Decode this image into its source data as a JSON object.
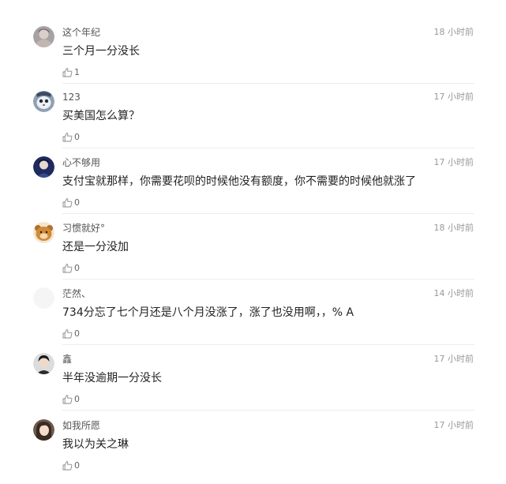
{
  "comments": [
    {
      "username": "这个年纪",
      "time": "18 小时前",
      "content": "三个月一分没长",
      "likes": "1",
      "avatar_icon": "avatar-icon"
    },
    {
      "username": "123",
      "time": "17 小时前",
      "content": "买美国怎么算？",
      "likes": "0",
      "avatar_icon": "avatar-icon"
    },
    {
      "username": "心不够用",
      "time": "17 小时前",
      "content": "支付宝就那样，你需要花呗的时候他没有额度，你不需要的时候他就涨了",
      "likes": "0",
      "avatar_icon": "avatar-icon"
    },
    {
      "username": "习惯就好°",
      "time": "18 小时前",
      "content": "还是一分没加",
      "likes": "0",
      "avatar_icon": "avatar-icon"
    },
    {
      "username": "茫然、",
      "time": "14 小时前",
      "content": "734分忘了七个月还是八个月没涨了，涨了也没用啊，，% A",
      "likes": "0",
      "avatar_icon": "avatar-icon"
    },
    {
      "username": "鑫",
      "time": "17 小时前",
      "content": "半年没逾期一分没长",
      "likes": "0",
      "avatar_icon": "avatar-icon"
    },
    {
      "username": "如我所愿",
      "time": "17 小时前",
      "content": "我以为关之琳",
      "likes": "0",
      "avatar_icon": "avatar-icon"
    }
  ],
  "colors": {
    "username": "#555555",
    "time": "#999999",
    "content": "#222222",
    "like": "#666666",
    "divider": "#ececec"
  }
}
